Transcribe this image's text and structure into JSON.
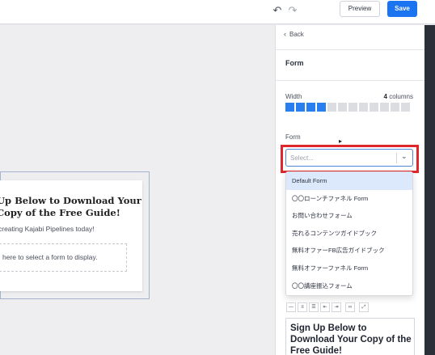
{
  "topbar": {
    "undo_icon": "undo-icon",
    "redo_icon": "redo-icon",
    "preview_label": "Preview",
    "save_label": "Save",
    "accent": "#1a73f0"
  },
  "canvas": {
    "heading": "Up Below to Download Your Copy of the Free Guide!",
    "subheading": "creating Kajabi Pipelines today!",
    "placeholder": "here to select a form to display."
  },
  "panel": {
    "back_label": "Back",
    "title": "Form",
    "width_label": "Width",
    "width_value_number": "4",
    "width_value_unit": "columns",
    "columns_total": 12,
    "columns_selected": 4,
    "form_label": "Form",
    "select_placeholder": "Select...",
    "options": [
      "Default Form",
      "〇〇ローンチファネル Form",
      "お問い合わせフォーム",
      "売れるコンテンツガイドブック",
      "無料オファーFB広告ガイドブック",
      "無料オファーファネル Form",
      "〇〇講座振込フォーム"
    ],
    "highlight_color": "#e0262d",
    "editor_text": "Sign Up Below to Download Your Copy of the Free Guide!"
  }
}
